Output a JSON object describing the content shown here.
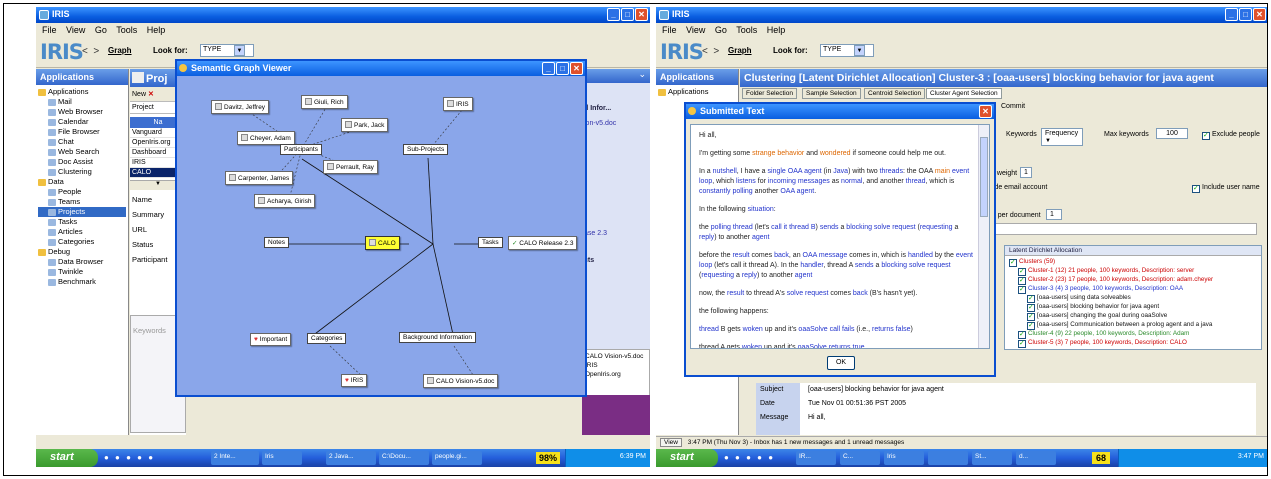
{
  "left": {
    "window_title": "IRIS",
    "menu": [
      "File",
      "View",
      "Go",
      "Tools",
      "Help"
    ],
    "logo": "IRIS",
    "nav_back": "<",
    "nav_forward": ">",
    "graph_button": "Graph",
    "look_for_label": "Look for:",
    "look_for_value": "TYPE",
    "applications_header": "Applications",
    "tree": [
      {
        "label": "Applications",
        "level": 0
      },
      {
        "label": "Mail",
        "level": 1
      },
      {
        "label": "Web Browser",
        "level": 1
      },
      {
        "label": "Calendar",
        "level": 1
      },
      {
        "label": "File Browser",
        "level": 1
      },
      {
        "label": "Chat",
        "level": 1
      },
      {
        "label": "Web Search",
        "level": 1
      },
      {
        "label": "Doc Assist",
        "level": 1
      },
      {
        "label": "Clustering",
        "level": 1
      },
      {
        "label": "Data",
        "level": 0
      },
      {
        "label": "People",
        "level": 1
      },
      {
        "label": "Teams",
        "level": 1
      },
      {
        "label": "Projects",
        "level": 1,
        "selected": true
      },
      {
        "label": "Tasks",
        "level": 1
      },
      {
        "label": "Articles",
        "level": 1
      },
      {
        "label": "Categories",
        "level": 1
      },
      {
        "label": "Debug",
        "level": 0
      },
      {
        "label": "Data Browser",
        "level": 1
      },
      {
        "label": "Twinkle",
        "level": 1
      },
      {
        "label": "Benchmark",
        "level": 1
      }
    ],
    "projects_panel": {
      "title": "Proj",
      "new_button": "New",
      "project_tab": "Project",
      "col_header": "Na",
      "rows": [
        "Vanguard",
        "OpenIris.org",
        "Dashboard",
        "IRIS",
        "CALO"
      ],
      "fields": [
        "Name",
        "Summary",
        "URL",
        "Status",
        "Participant"
      ],
      "keywords_label": "Keywords"
    },
    "right_panel": {
      "info_title": "d Infor...",
      "doc": "ion-v5.doc",
      "release": "ase 2.3",
      "cts": "cts",
      "files": [
        "CALO Vision-v5.doc",
        "IRIS",
        "OpenIris.org"
      ]
    },
    "graph_viewer": {
      "title": "Semantic Graph Viewer",
      "center": "CALO",
      "hubs": {
        "participants": "Participants",
        "subprojects": "Sub-Projects",
        "notes": "Notes",
        "tasks": "Tasks",
        "categories": "Categories",
        "background": "Background Information"
      },
      "people": [
        "Davitz, Jeffrey",
        "Giuli, Rich",
        "Park, Jack",
        "Cheyer, Adam",
        "Perrault, Ray",
        "Carpenter, James",
        "Acharya, Girish"
      ],
      "subproject": "IRIS",
      "task": "CALO Release 2.3",
      "category": "Important",
      "background_items": [
        "IRIS",
        "CALO Vision-v5.doc"
      ]
    },
    "taskbar": {
      "start": "start",
      "items": [
        "2 Inte...",
        "Iris",
        "2 Java...",
        "C:\\Docu...",
        "people.gi..."
      ],
      "battery": "98%",
      "time": "6:39 PM"
    }
  },
  "right": {
    "window_title": "IRIS",
    "menu": [
      "File",
      "View",
      "Go",
      "Tools",
      "Help"
    ],
    "logo": "IRIS",
    "graph_button": "Graph",
    "look_for_label": "Look for:",
    "look_for_value": "TYPE",
    "applications_header": "Applications",
    "tree_top": "Applications",
    "clustering_title": "Clustering   [Latent Dirichlet Allocation]  Cluster-3 : [oaa-users] blocking behavior for java agent",
    "subtabs": [
      "Folder Selection",
      "Sample Selection",
      "Centroid Selection",
      "Cluster Agent Selection"
    ],
    "commit": "Commit",
    "keywords_label": "Keywords",
    "keywords_value": "Frequency",
    "max_keywords_label": "Max keywords",
    "max_keywords_value": "100",
    "exclude_people": "Exclude people",
    "weight_label": "t weight",
    "weight_value": "1",
    "email_account": "lude email account",
    "include_user_name": "Include user name",
    "per_document": "rs per document",
    "per_document_value": "1",
    "lda_header": "Latent Dirichlet Allocation",
    "clusters": [
      {
        "text": "Clusters (59)",
        "color": "red",
        "level": 0
      },
      {
        "text": "Cluster-1 (12) 21 people, 100 keywords, Description: server",
        "color": "red",
        "level": 1
      },
      {
        "text": "Cluster-2 (23) 17 people, 100 keywords, Description: adam.cheyer",
        "color": "red",
        "level": 1
      },
      {
        "text": "Cluster-3 (4) 3 people, 100 keywords, Description: OAA",
        "color": "blue",
        "level": 1
      },
      {
        "text": "[oaa-users] using data solveables",
        "color": "black",
        "level": 2
      },
      {
        "text": "[oaa-users] blocking behavior for java agent",
        "color": "black",
        "level": 2
      },
      {
        "text": "[oaa-users] changing the goal during oaaSolve",
        "color": "black",
        "level": 2
      },
      {
        "text": "[oaa-users] Communication between a prolog agent and a java",
        "color": "black",
        "level": 2
      },
      {
        "text": "Cluster-4 (9) 22 people, 100 keywords, Description: Adam",
        "color": "green",
        "level": 1
      },
      {
        "text": "Cluster-5 (3) 7 people, 100 keywords, Description: CALO",
        "color": "red",
        "level": 1
      }
    ],
    "message": {
      "subject_label": "Subject",
      "subject": "[oaa-users] blocking behavior for java agent",
      "date_label": "Date",
      "date": "Tue Nov 01 00:51:36 PST 2005",
      "message_label": "Message",
      "message": "Hi all,"
    },
    "status": {
      "view": "View",
      "text": "3:47 PM (Thu Nov 3) - Inbox has 1 new messages and 1 unread messages"
    },
    "submitted": {
      "title": "Submitted Text",
      "ok": "OK",
      "paragraphs": [
        [
          {
            "t": "Hi all,",
            "c": ""
          }
        ],
        [
          {
            "t": "I'm getting some ",
            "c": ""
          },
          {
            "t": "strange behavior",
            "c": "o"
          },
          {
            "t": " and ",
            "c": ""
          },
          {
            "t": "wondered",
            "c": "o"
          },
          {
            "t": " if someone could help me out.",
            "c": ""
          }
        ],
        [
          {
            "t": "In a ",
            "c": ""
          },
          {
            "t": "nutshell",
            "c": "b"
          },
          {
            "t": ", I have a ",
            "c": ""
          },
          {
            "t": "single OAA agent",
            "c": "b"
          },
          {
            "t": " (in ",
            "c": ""
          },
          {
            "t": "Java",
            "c": "b"
          },
          {
            "t": ") with two ",
            "c": ""
          },
          {
            "t": "threads",
            "c": "b"
          },
          {
            "t": ": the OAA ",
            "c": ""
          },
          {
            "t": "main",
            "c": "o"
          },
          {
            "t": " ",
            "c": ""
          },
          {
            "t": "event loop",
            "c": "b"
          },
          {
            "t": ", which ",
            "c": ""
          },
          {
            "t": "listens",
            "c": "b"
          },
          {
            "t": " for ",
            "c": ""
          },
          {
            "t": "incoming messages",
            "c": "b"
          },
          {
            "t": " as ",
            "c": ""
          },
          {
            "t": "normal",
            "c": "b"
          },
          {
            "t": ", and another ",
            "c": ""
          },
          {
            "t": "thread",
            "c": "b"
          },
          {
            "t": ", which is ",
            "c": ""
          },
          {
            "t": "constantly polling",
            "c": "b"
          },
          {
            "t": " another ",
            "c": ""
          },
          {
            "t": "OAA agent",
            "c": "b"
          },
          {
            "t": ".",
            "c": ""
          }
        ],
        [
          {
            "t": "In the following ",
            "c": ""
          },
          {
            "t": "situation",
            "c": "b"
          },
          {
            "t": ":",
            "c": ""
          }
        ],
        [
          {
            "t": "the ",
            "c": ""
          },
          {
            "t": "polling thread",
            "c": "b"
          },
          {
            "t": " (let's ",
            "c": ""
          },
          {
            "t": "call it thread B",
            "c": "b"
          },
          {
            "t": ") ",
            "c": ""
          },
          {
            "t": "sends",
            "c": "b"
          },
          {
            "t": " a ",
            "c": ""
          },
          {
            "t": "blocking solve request",
            "c": "b"
          },
          {
            "t": " (",
            "c": ""
          },
          {
            "t": "requesting",
            "c": "b"
          },
          {
            "t": " a ",
            "c": ""
          },
          {
            "t": "reply",
            "c": "b"
          },
          {
            "t": ") to another ",
            "c": ""
          },
          {
            "t": "agent",
            "c": "b"
          }
        ],
        [
          {
            "t": "before the ",
            "c": ""
          },
          {
            "t": "result",
            "c": "b"
          },
          {
            "t": " comes ",
            "c": ""
          },
          {
            "t": "back",
            "c": "b"
          },
          {
            "t": ", an ",
            "c": ""
          },
          {
            "t": "OAA message",
            "c": "b"
          },
          {
            "t": " comes in, which is ",
            "c": ""
          },
          {
            "t": "handled",
            "c": "b"
          },
          {
            "t": " by the ",
            "c": ""
          },
          {
            "t": "event loop",
            "c": "b"
          },
          {
            "t": " (let's call it thread A). In the ",
            "c": ""
          },
          {
            "t": "handler",
            "c": "b"
          },
          {
            "t": ", thread A ",
            "c": ""
          },
          {
            "t": "sends",
            "c": "b"
          },
          {
            "t": " a ",
            "c": ""
          },
          {
            "t": "blocking solve request",
            "c": "b"
          },
          {
            "t": " (",
            "c": ""
          },
          {
            "t": "requesting",
            "c": "b"
          },
          {
            "t": " a ",
            "c": ""
          },
          {
            "t": "reply",
            "c": "b"
          },
          {
            "t": ") to another ",
            "c": ""
          },
          {
            "t": "agent",
            "c": "b"
          }
        ],
        [
          {
            "t": "now, the ",
            "c": ""
          },
          {
            "t": "result",
            "c": "b"
          },
          {
            "t": " to thread A's ",
            "c": ""
          },
          {
            "t": "solve request",
            "c": "b"
          },
          {
            "t": " comes ",
            "c": ""
          },
          {
            "t": "back",
            "c": "b"
          },
          {
            "t": " (B's hasn't yet).",
            "c": ""
          }
        ],
        [
          {
            "t": "the following happens:",
            "c": ""
          }
        ],
        [
          {
            "t": "thread",
            "c": "b"
          },
          {
            "t": " B gets ",
            "c": ""
          },
          {
            "t": "woken",
            "c": "b"
          },
          {
            "t": " up and it's ",
            "c": ""
          },
          {
            "t": "oaaSolve",
            "c": "b"
          },
          {
            "t": " ",
            "c": ""
          },
          {
            "t": "call fails",
            "c": "b"
          },
          {
            "t": " (i.e., ",
            "c": ""
          },
          {
            "t": "returns false",
            "c": "b"
          },
          {
            "t": ")",
            "c": ""
          }
        ],
        [
          {
            "t": "thread A gets ",
            "c": ""
          },
          {
            "t": "woken",
            "c": "b"
          },
          {
            "t": " up and it's ",
            "c": ""
          },
          {
            "t": "oaaSolve returns true",
            "c": "b"
          }
        ]
      ]
    },
    "taskbar": {
      "start": "start",
      "items": [
        "IR...",
        "C...",
        "Iris",
        "",
        "St...",
        "d..."
      ],
      "battery": "68",
      "time": "3:47 PM"
    }
  }
}
